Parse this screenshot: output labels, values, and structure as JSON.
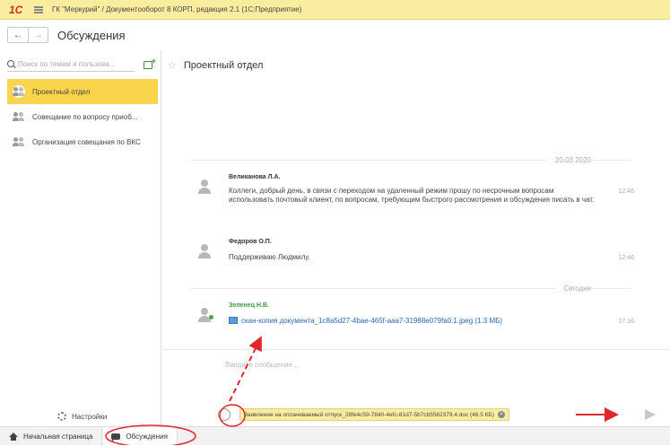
{
  "window": {
    "title": "ГК \"Меркурий\" / Документооборот 8 КОРП, редакция 2.1  (1С:Предприятие)",
    "logo": "1С"
  },
  "nav": {
    "back": "←",
    "forward": "→",
    "form_title": "Обсуждения"
  },
  "sidebar": {
    "search_placeholder": "Поиск по темам и пользова...",
    "items": [
      {
        "label": "Проектный отдел",
        "active": true
      },
      {
        "label": "Совещание по вопросу приоб..."
      },
      {
        "label": "Организация совещания по ВКС"
      }
    ],
    "settings_label": "Настройки"
  },
  "chat": {
    "title": "Проектный отдел",
    "date1": "20.03.2020",
    "date2": "Сегодня",
    "messages": [
      {
        "author": "Великанова Л.А.",
        "text": "Коллеги, добрый день, в связи с переходом на удаленный режим прошу по несрочным вопросам использовать почтовый клиент, по вопросам, требующим быстрого рассмотрения и обсуждения писать в чат.",
        "time": "12:46"
      },
      {
        "author": "Федоров О.П.",
        "text": "Поддерживаю Людмилу.",
        "time": "12:46"
      },
      {
        "author": "Зеленец Н.В.",
        "file": "скан-копия документа_1c8a5d27-4bae-465f-aaa7-31988e079fa0.1.jpeg (1.3 МБ)",
        "time": "17:16"
      }
    ],
    "input_placeholder": "Введите сообщение...",
    "attachment": "Заявление на оплачиваемый отпуск_28fe4c59-7840-4efc-81d7-5b7cb5562379.4.doc (46.5 КБ)"
  },
  "taskbar": {
    "home_label": "Начальная страница",
    "discussions_label": "Обсуждения"
  },
  "colors": {
    "accent": "#fad54b",
    "titlebar": "#fbeda0",
    "annotation": "#e3262b",
    "online": "#42a848",
    "link": "#2a66b6"
  }
}
